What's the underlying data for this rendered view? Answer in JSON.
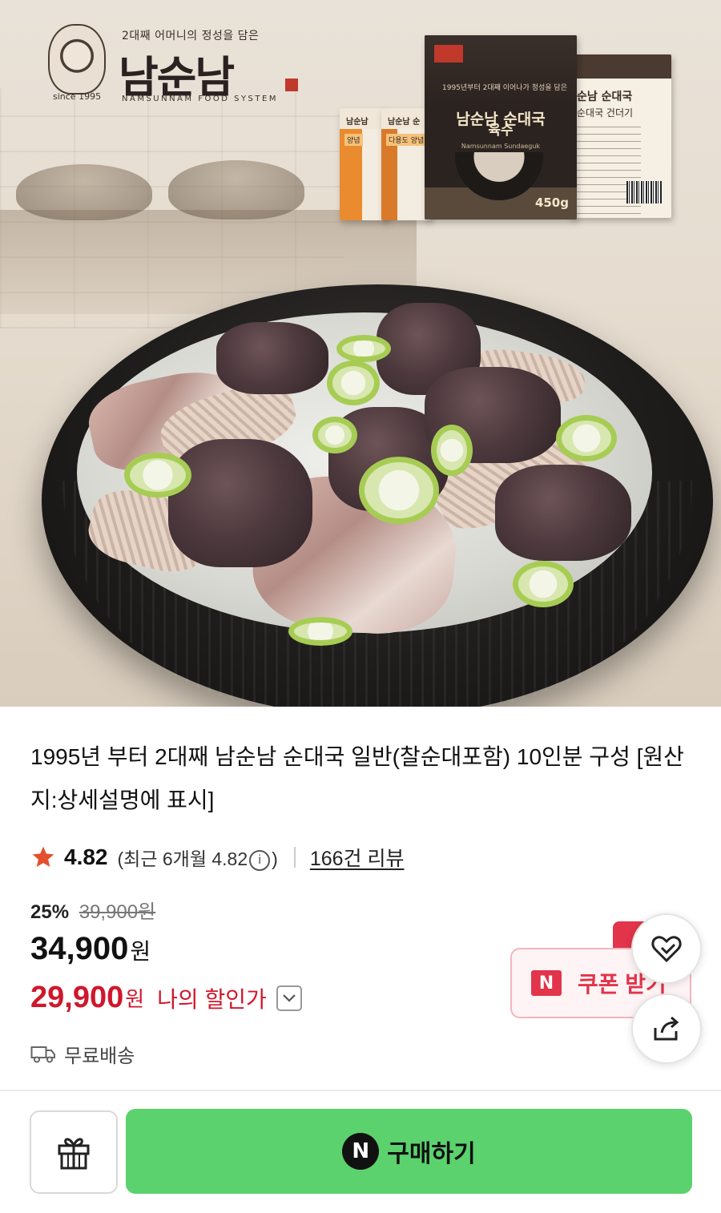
{
  "hero": {
    "brand_tagline": "2대째 어머니의 정성을 담은",
    "brand_name": "남순남",
    "brand_since": "since 1995",
    "brand_english": "NAMSUNNAM FOOD SYSTEM",
    "package_main_line1": "남순남 순대국",
    "package_main_line2": "육수",
    "package_main_small": "1995년부터 2대째 이어나가 정성을 담은",
    "package_main_english": "Namsunnam Sundaeguk",
    "package_main_weight": "450g",
    "package_back_line1": "순남 순대국",
    "package_back_line2": "순대국 건더기",
    "package_small1_label": "남순남",
    "package_small1_sub": "양념",
    "package_small2_label": "남순남 순",
    "package_small2_sub": "다용도 양념"
  },
  "product": {
    "title": "1995년 부터 2대째 남순남 순대국 일반(찰순대포함) 10인분 구성 [원산지:상세설명에 표시]",
    "rating": "4.82",
    "recent_prefix": "(최근 6개월 4.82",
    "recent_suffix": ")",
    "info_symbol": "i",
    "reviews": "166건 리뷰",
    "discount_rate": "25%",
    "original_price": "39,900원",
    "price": "34,900",
    "price_unit": "원",
    "my_price": "29,900",
    "my_price_unit": "원",
    "my_price_label": "나의 할인가",
    "shipping": "무료배송"
  },
  "coupon": {
    "badge": "N",
    "label": "쿠폰 받기"
  },
  "actions": {
    "buy_badge": "N",
    "buy_label": "구매하기"
  },
  "colors": {
    "accent_red": "#d0172c",
    "buy_green": "#5bd26e",
    "star": "#e4502e"
  },
  "icons": [
    "star-icon",
    "info-icon",
    "chevron-down-icon",
    "truck-icon",
    "heart-icon",
    "share-icon",
    "gift-icon"
  ]
}
